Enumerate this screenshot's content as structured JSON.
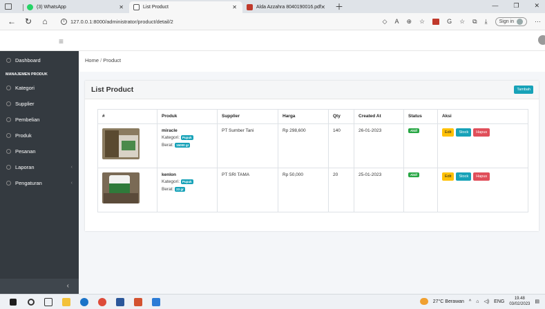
{
  "browser": {
    "tabs": [
      {
        "label": "(3) WhatsApp",
        "color": "#25d366"
      },
      {
        "label": "List Product",
        "color": "#ffffff"
      },
      {
        "label": "Alda Azzahra 8040190016.pdf",
        "color": "#c0392b"
      }
    ],
    "url": "127.0.0.1:8000/administrator/product/detail/2",
    "signin_label": "Sign in"
  },
  "sidebar": {
    "items_top": [
      {
        "label": "Dashboard"
      }
    ],
    "section_header": "MANAJEMEN PRODUK",
    "items": [
      {
        "label": "Kategori",
        "icon": "circle-icon",
        "has_chevron": false
      },
      {
        "label": "Supplier",
        "icon": "circle-icon",
        "has_chevron": false
      },
      {
        "label": "Pembelian",
        "icon": "circle-icon",
        "has_chevron": false
      },
      {
        "label": "Produk",
        "icon": "circle-icon",
        "has_chevron": false
      },
      {
        "label": "Pesanan",
        "icon": "circle-icon",
        "has_chevron": false
      },
      {
        "label": "Laporan",
        "icon": "gear-icon",
        "has_chevron": true
      },
      {
        "label": "Pengaturan",
        "icon": "gear-icon",
        "has_chevron": true
      }
    ],
    "collapse_glyph": "‹"
  },
  "breadcrumb": {
    "home": "Home",
    "sep": "/",
    "current": "Product"
  },
  "card": {
    "title": "List Product",
    "add_button": "Tambah"
  },
  "table": {
    "headers": [
      "#",
      "Produk",
      "Supplier",
      "Harga",
      "Qty",
      "Created At",
      "Status",
      "Aksi"
    ],
    "rows": [
      {
        "name": "miracle",
        "kategori_label": "Kategori:",
        "kategori": "Pupuk",
        "berat_label": "Berat:",
        "berat": "15000 gr",
        "supplier": "PT Sumber Tani",
        "harga": "Rp 298,600",
        "qty": "140",
        "created_at": "26-01-2023",
        "status": "Aktif"
      },
      {
        "name": "kenlon",
        "kategori_label": "Kategori:",
        "kategori": "Pupuk",
        "berat_label": "Berat:",
        "berat": "23 gr",
        "supplier": "PT SRI TAMA",
        "harga": "Rp 50,000",
        "qty": "20",
        "created_at": "25-01-2023",
        "status": "Aktif"
      }
    ],
    "actions": {
      "edit": "Edit",
      "stock": "Stock",
      "hapus": "Hapus"
    }
  },
  "taskbar": {
    "weather": "27°C Berawan",
    "lang": "ENG",
    "time": "19.48",
    "date": "03/02/2023"
  }
}
